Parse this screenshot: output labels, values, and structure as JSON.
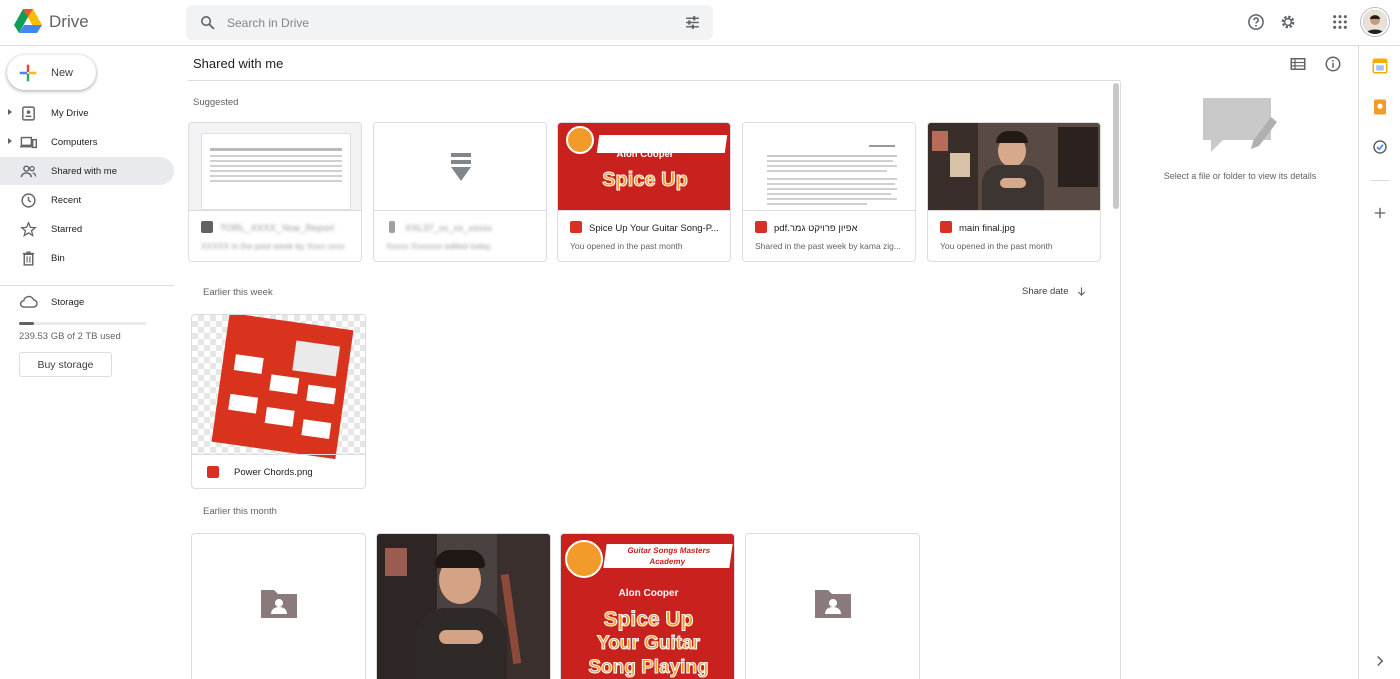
{
  "app": {
    "name": "Drive"
  },
  "search": {
    "placeholder": "Search in Drive"
  },
  "new_button": {
    "label": "New"
  },
  "nav": [
    {
      "label": "My Drive",
      "icon": "my-drive-icon",
      "expandable": true,
      "active": false
    },
    {
      "label": "Computers",
      "icon": "computers-icon",
      "expandable": true,
      "active": false
    },
    {
      "label": "Shared with me",
      "icon": "shared-icon",
      "expandable": false,
      "active": true
    },
    {
      "label": "Recent",
      "icon": "clock-icon",
      "expandable": false,
      "active": false
    },
    {
      "label": "Starred",
      "icon": "star-icon",
      "expandable": false,
      "active": false
    },
    {
      "label": "Bin",
      "icon": "bin-icon",
      "expandable": false,
      "active": false
    }
  ],
  "storage": {
    "label": "Storage",
    "used_text": "239.53 GB of 2 TB used",
    "used_fraction": 0.117,
    "buy_label": "Buy storage"
  },
  "main": {
    "title": "Shared with me",
    "suggested_label": "Suggested",
    "suggested": [
      {
        "name": "TORL_XXXX_Year_Report",
        "sub": "XXXXX in the past week by Xxxx xxxx",
        "type": "sheet",
        "blurred": true
      },
      {
        "name": "XXL37_xx_xx_xxxxx",
        "sub": "Xxxxx Xxxxxxx edited today",
        "type": "file",
        "blurred": true
      },
      {
        "name": "Spice Up Your Guitar Song-P...",
        "sub": "You opened in the past month",
        "type": "pdf",
        "blurred": false
      },
      {
        "name": "pdf.אפיון פרויקט גמר",
        "sub": "Shared in the past week by kama zig...",
        "type": "pdf",
        "blurred": false
      },
      {
        "name": "main final.jpg",
        "sub": "You opened in the past month",
        "type": "image",
        "blurred": false
      }
    ],
    "week_label": "Earlier this week",
    "sort_label": "Share date",
    "week_files": [
      {
        "name": "Power Chords.png",
        "type": "image"
      }
    ],
    "month_label": "Earlier this month",
    "poster": {
      "brand_line1": "Guitar Songs Masters",
      "brand_line2": "Academy",
      "author": "Alon Cooper",
      "title_line1": "Spice Up",
      "title_line2": "Your Guitar",
      "title_line3": "Song Playing"
    }
  },
  "details": {
    "message": "Select a file or folder to view its details"
  },
  "colors": {
    "accent_red": "#d93025",
    "poster_red": "#c9211e",
    "poster_orange": "#f29b2a",
    "active_nav": "#e8eaed"
  }
}
